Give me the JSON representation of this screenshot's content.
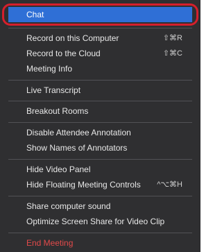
{
  "menu": {
    "chat": "Chat",
    "record_computer": "Record on this Computer",
    "record_computer_shortcut": "⇧⌘R",
    "record_cloud": "Record to the Cloud",
    "record_cloud_shortcut": "⇧⌘C",
    "meeting_info": "Meeting Info",
    "live_transcript": "Live Transcript",
    "breakout_rooms": "Breakout Rooms",
    "disable_annotation": "Disable Attendee Annotation",
    "show_annotators": "Show Names of Annotators",
    "hide_video_panel": "Hide Video Panel",
    "hide_floating_controls": "Hide Floating Meeting Controls",
    "hide_floating_controls_shortcut": "^⌥⌘H",
    "share_sound": "Share computer sound",
    "optimize_share": "Optimize Screen Share for Video Clip",
    "end_meeting": "End Meeting"
  },
  "colors": {
    "menu_bg": "#2f2f31",
    "selected_bg": "#2f6fd6",
    "danger": "#e24a4a",
    "highlight_ring": "#d61f2c"
  }
}
